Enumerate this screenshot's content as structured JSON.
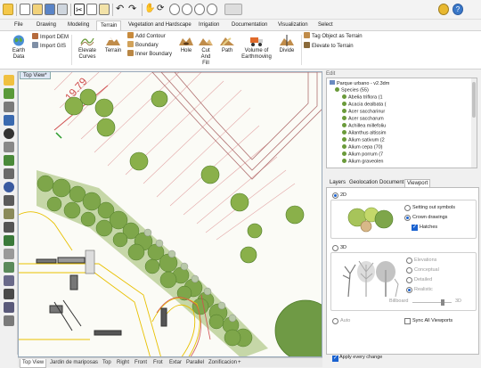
{
  "quickbar": {
    "icons": [
      "app-menu-icon",
      "new-file-icon",
      "open-folder-icon",
      "save-icon",
      "print-icon",
      "cut-icon",
      "copy-icon",
      "paste-icon",
      "undo-icon",
      "redo-icon",
      "pan-icon",
      "rotate-icon",
      "zoom-icon",
      "zoom-extents-icon",
      "zoom-window-icon",
      "zoom-selected-icon",
      "view-options-icon",
      "settings-gear-icon",
      "help-icon"
    ]
  },
  "menu": {
    "tabs": [
      "File",
      "Drawing",
      "Modeling",
      "Terrain",
      "Vegetation and Hardscape",
      "Irrigation",
      "Documentation",
      "Visualization",
      "Select"
    ],
    "active": "Terrain"
  },
  "ribbon": {
    "earth_data": "Earth\nData",
    "import_dem": "Import DEM",
    "import_gis": "Import GIS",
    "elevate_curves": "Elevate\nCurves",
    "terrain": "Terrain",
    "add_contour": "Add Contour",
    "boundary": "Boundary",
    "inner_boundary": "Inner Boundary",
    "hole": "Hole",
    "cut_and_fill": "Cut\nAnd\nFill",
    "path": "Path",
    "volume_of_earthmoving": "Volume of\nEarthmoving",
    "divide": "Divide",
    "tag_object_as_terrain": "Tag Object as Terrain",
    "elevate_to_terrain": "Elevate to Terrain"
  },
  "viewport": {
    "title": "Top View*",
    "dimension_label": "19.79"
  },
  "bottom_tabs": [
    "Top View",
    "Jardin de mariposas",
    "Top",
    "Right",
    "Front",
    "Frot",
    "Extar",
    "Parallel",
    "Zonificacion"
  ],
  "bottom_active": "Top View",
  "edit_panel": {
    "label": "Edit",
    "tree_root": "Parque urbano - v2.3dm",
    "species_group": "Species (55)",
    "species": [
      "Abelia triflora (1",
      "Acacia dealbata (",
      "Acer saccharinur",
      "Acer saccharum",
      "Achillea millefoliu",
      "Ailanthus altissim",
      "Alium sativum (2",
      "Alium cepa (70)",
      "Alium porrum (7",
      "Alium graveolen"
    ]
  },
  "panel_tabs": [
    "Layers",
    "Geolocation",
    "Document",
    "Viewport"
  ],
  "panel_active": "Viewport",
  "viewport_panel": {
    "mode_2d": "2D",
    "setting_out_symbols": "Setting out symbols",
    "crown_drawings": "Crown drawings",
    "hatches": "Hatches",
    "mode_3d": "3D",
    "elevations": "Elevations",
    "conceptual": "Conceptual",
    "detailed": "Detailed",
    "realistic": "Realistic",
    "billboard": "Billboard",
    "slider_3d": "3D",
    "auto": "Auto",
    "sync_all_viewports": "Sync All Viewports",
    "apply_every_change": "Apply every change"
  },
  "colors": {
    "accent": "#1a62d0",
    "tree_fill": "#8ab04a",
    "tree_dark": "#4d7a28",
    "contour_red": "#d05050",
    "path_yellow": "#e8c000"
  }
}
